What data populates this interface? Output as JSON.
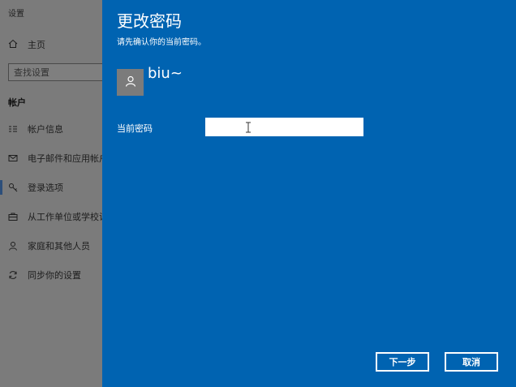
{
  "settings": {
    "window_title": "设置",
    "home_label": "主页",
    "search_placeholder": "查找设置",
    "section_label": "帐户",
    "nav_items": [
      {
        "label": "帐户信息",
        "icon": "account-info-icon"
      },
      {
        "label": "电子邮件和应用帐户",
        "icon": "mail-icon"
      },
      {
        "label": "登录选项",
        "icon": "key-icon"
      },
      {
        "label": "从工作单位或学校访问",
        "icon": "briefcase-icon"
      },
      {
        "label": "家庭和其他人员",
        "icon": "person-icon"
      },
      {
        "label": "同步你的设置",
        "icon": "sync-icon"
      }
    ]
  },
  "dialog": {
    "title": "更改密码",
    "subtitle": "请先确认你的当前密码。",
    "username": "biu~",
    "current_password_label": "当前密码",
    "current_password_value": "",
    "next_button": "下一步",
    "cancel_button": "取消"
  },
  "colors": {
    "dialog_blue": "#0063b1",
    "backdrop_gray": "#7b7b7b"
  }
}
